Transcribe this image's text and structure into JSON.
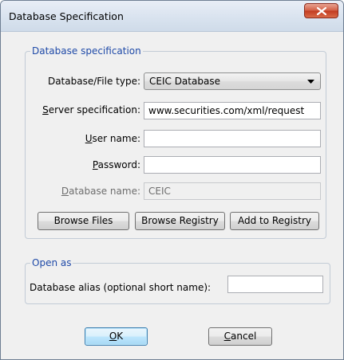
{
  "window": {
    "title": "Database Specification"
  },
  "group_spec": {
    "title": "Database specification",
    "type_label": "Database/File type:",
    "type_value": "CEIC Database",
    "server_label_u": "S",
    "server_label_rest": "erver specification:",
    "server_value": "www.securities.com/xml/request",
    "user_label_u": "U",
    "user_label_rest": "ser name:",
    "user_value": "",
    "password_label_u": "P",
    "password_label_rest": "assword:",
    "password_value": "",
    "dbname_label_u": "D",
    "dbname_label_rest": "atabase name:",
    "dbname_value": "CEIC",
    "browse_files": "Browse Files",
    "browse_registry": "Browse Registry",
    "add_to_registry": "Add to Registry"
  },
  "group_open": {
    "title": "Open as",
    "alias_label": "Database alias (optional short name):",
    "alias_value": ""
  },
  "footer": {
    "ok_u": "O",
    "ok_rest": "K",
    "cancel_u": "C",
    "cancel_rest": "ancel"
  }
}
